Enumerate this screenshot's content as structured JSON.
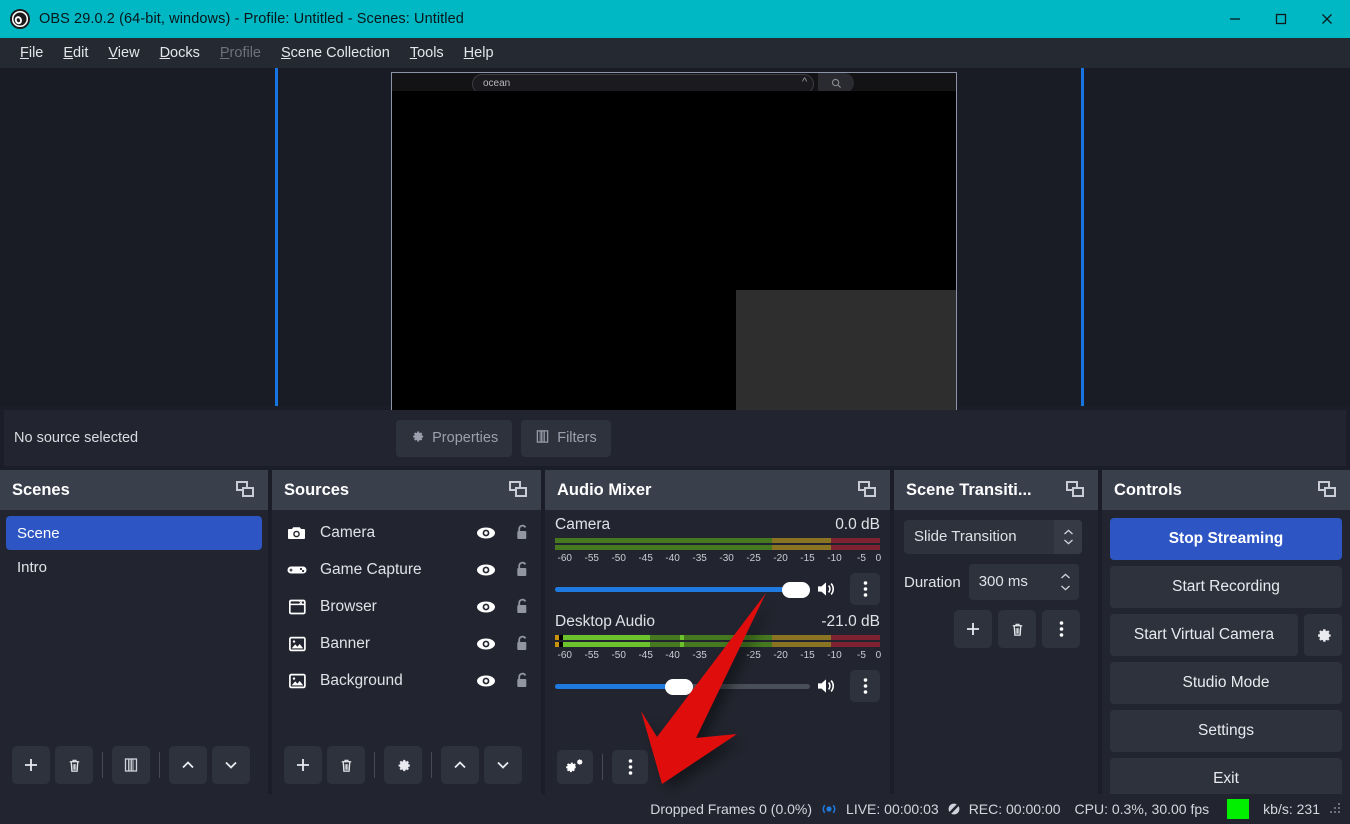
{
  "window": {
    "title": "OBS 29.0.2 (64-bit, windows) - Profile: Untitled - Scenes: Untitled",
    "app_icon": "obs-logo-icon",
    "minimize_label": "Minimize",
    "maximize_label": "Maximize",
    "close_label": "Close",
    "titlebar_color": "#00b8c4"
  },
  "menubar": {
    "items": [
      {
        "label": "File",
        "accel": "F",
        "disabled": false
      },
      {
        "label": "Edit",
        "accel": "E",
        "disabled": false
      },
      {
        "label": "View",
        "accel": "V",
        "disabled": false
      },
      {
        "label": "Docks",
        "accel": "D",
        "disabled": false
      },
      {
        "label": "Profile",
        "accel": "P",
        "disabled": true
      },
      {
        "label": "Scene Collection",
        "accel": "S",
        "disabled": false
      },
      {
        "label": "Tools",
        "accel": "T",
        "disabled": false
      },
      {
        "label": "Help",
        "accel": "H",
        "disabled": false
      }
    ]
  },
  "preview": {
    "embedded": {
      "search_value": "ocean",
      "chevron_icon": "chevron-up-icon",
      "search_icon": "magnifier-icon"
    },
    "guide_color": "#1675e0"
  },
  "source_toolbar": {
    "status": "No source selected",
    "properties_label": "Properties",
    "properties_icon": "gear-icon",
    "filters_label": "Filters",
    "filters_icon": "filters-icon"
  },
  "scenes": {
    "title": "Scenes",
    "float_icon": "float-dock-icon",
    "items": [
      {
        "label": "Scene",
        "selected": true
      },
      {
        "label": "Intro",
        "selected": false
      }
    ],
    "tools": [
      {
        "name": "add-scene-button",
        "icon": "plus-icon"
      },
      {
        "name": "remove-scene-button",
        "icon": "trash-icon"
      },
      {
        "name": "scene-filters-button",
        "icon": "filters-icon"
      },
      {
        "name": "move-scene-up-button",
        "icon": "chevron-up-icon"
      },
      {
        "name": "move-scene-down-button",
        "icon": "chevron-down-icon"
      }
    ]
  },
  "sources": {
    "title": "Sources",
    "float_icon": "float-dock-icon",
    "items": [
      {
        "label": "Camera",
        "icon": "camera-icon",
        "visible": true,
        "locked": false
      },
      {
        "label": "Game Capture",
        "icon": "gamepad-icon",
        "visible": true,
        "locked": false
      },
      {
        "label": "Browser",
        "icon": "browser-icon",
        "visible": true,
        "locked": false
      },
      {
        "label": "Banner",
        "icon": "image-icon",
        "visible": true,
        "locked": false
      },
      {
        "label": "Background",
        "icon": "image-icon",
        "visible": true,
        "locked": false
      }
    ],
    "tools": [
      {
        "name": "add-source-button",
        "icon": "plus-icon"
      },
      {
        "name": "remove-source-button",
        "icon": "trash-icon"
      },
      {
        "name": "source-properties-button",
        "icon": "gear-icon"
      },
      {
        "name": "move-source-up-button",
        "icon": "chevron-up-icon"
      },
      {
        "name": "move-source-down-button",
        "icon": "chevron-down-icon"
      }
    ]
  },
  "audio_mixer": {
    "title": "Audio Mixer",
    "float_icon": "float-dock-icon",
    "meter_ticks": [
      "-60",
      "-55",
      "-50",
      "-45",
      "-40",
      "-35",
      "-30",
      "-25",
      "-20",
      "-15",
      "-10",
      "-5",
      "0"
    ],
    "tracks": [
      {
        "name": "Camera",
        "db": "0.0 dB",
        "volume_percent": 100,
        "signal_percent": 0,
        "peak_percent": 0,
        "muted": false,
        "speaker_icon": "speaker-on-icon",
        "menu_icon": "vertical-dots-icon"
      },
      {
        "name": "Desktop Audio",
        "db": "-21.0 dB",
        "volume_percent": 48,
        "signal_percent": 29,
        "peak_percent": 42,
        "muted": false,
        "speaker_icon": "speaker-on-icon",
        "menu_icon": "vertical-dots-icon"
      }
    ],
    "tools": [
      {
        "name": "audio-advanced-properties-button",
        "icon": "gears-icon"
      },
      {
        "name": "audio-mixer-menu-button",
        "icon": "vertical-dots-icon"
      }
    ]
  },
  "scene_transitions": {
    "title": "Scene Transiti...",
    "float_icon": "float-dock-icon",
    "transition_value": "Slide Transition",
    "duration_label": "Duration",
    "duration_value": "300 ms",
    "tools": [
      {
        "name": "add-transition-button",
        "icon": "plus-icon"
      },
      {
        "name": "remove-transition-button",
        "icon": "trash-icon"
      },
      {
        "name": "transition-menu-button",
        "icon": "vertical-dots-icon"
      }
    ]
  },
  "controls": {
    "title": "Controls",
    "float_icon": "float-dock-icon",
    "stop_streaming": "Stop Streaming",
    "start_recording": "Start Recording",
    "start_virtual_camera": "Start Virtual Camera",
    "virtual_camera_settings_icon": "gear-icon",
    "studio_mode": "Studio Mode",
    "settings": "Settings",
    "exit": "Exit",
    "primary_color": "#2d55c4"
  },
  "statusbar": {
    "dropped_frames": "Dropped Frames 0 (0.0%)",
    "live_icon": "broadcast-icon",
    "live": "LIVE: 00:00:03",
    "rec_icon": "rec-disabled-icon",
    "rec": "REC: 00:00:00",
    "cpu": "CPU: 0.3%, 30.00 fps",
    "bitrate_indicator_color": "#00f000",
    "kbps": "kb/s: 231",
    "resize_grip_icon": "resize-grip-icon"
  },
  "annotation": {
    "arrow_color": "#e01010",
    "arrow_name": "red-pointer-arrow"
  }
}
